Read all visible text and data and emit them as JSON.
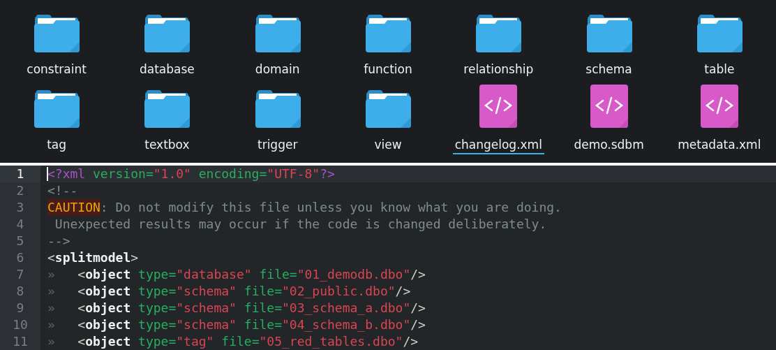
{
  "files": [
    {
      "kind": "folder",
      "name": "constraint",
      "selected": false
    },
    {
      "kind": "folder",
      "name": "database",
      "selected": false
    },
    {
      "kind": "folder",
      "name": "domain",
      "selected": false
    },
    {
      "kind": "folder",
      "name": "function",
      "selected": false
    },
    {
      "kind": "folder",
      "name": "relationship",
      "selected": false
    },
    {
      "kind": "folder",
      "name": "schema",
      "selected": false
    },
    {
      "kind": "folder",
      "name": "table",
      "selected": false
    },
    {
      "kind": "folder",
      "name": "tag",
      "selected": false
    },
    {
      "kind": "folder",
      "name": "textbox",
      "selected": false
    },
    {
      "kind": "folder",
      "name": "trigger",
      "selected": false
    },
    {
      "kind": "folder",
      "name": "view",
      "selected": false
    },
    {
      "kind": "code",
      "name": "changelog.xml",
      "selected": true
    },
    {
      "kind": "code",
      "name": "demo.sdbm",
      "selected": false
    },
    {
      "kind": "code",
      "name": "metadata.xml",
      "selected": false
    }
  ],
  "editor": {
    "lines": [
      {
        "number": "1",
        "current": true,
        "tokens": [
          {
            "kind": "pi",
            "text": "<?xml"
          },
          {
            "kind": "attr",
            "text": " version="
          },
          {
            "kind": "string",
            "text": "\"1.0\""
          },
          {
            "kind": "attr",
            "text": " encoding="
          },
          {
            "kind": "string",
            "text": "\"UTF-8\""
          },
          {
            "kind": "pi",
            "text": "?>"
          }
        ]
      },
      {
        "number": "2",
        "current": false,
        "tokens": [
          {
            "kind": "comment",
            "text": "<!--"
          }
        ]
      },
      {
        "number": "3",
        "current": false,
        "tokens": [
          {
            "kind": "caution",
            "text": "CAUTION"
          },
          {
            "kind": "comment",
            "text": ": Do not modify this file unless you know what you are doing."
          }
        ]
      },
      {
        "number": "4",
        "current": false,
        "tokens": [
          {
            "kind": "comment",
            "text": " Unexpected results may occur if the code is changed deliberately."
          }
        ]
      },
      {
        "number": "5",
        "current": false,
        "tokens": [
          {
            "kind": "comment",
            "text": "-->"
          }
        ]
      },
      {
        "number": "6",
        "current": false,
        "tokens": [
          {
            "kind": "punct",
            "text": "<"
          },
          {
            "kind": "tag",
            "text": "splitmodel"
          },
          {
            "kind": "punct",
            "text": ">"
          }
        ]
      },
      {
        "number": "7",
        "current": false,
        "tokens": [
          {
            "kind": "indent",
            "text": "»"
          },
          {
            "kind": "punct",
            "text": "   <"
          },
          {
            "kind": "tag",
            "text": "object"
          },
          {
            "kind": "attr",
            "text": " type="
          },
          {
            "kind": "string",
            "text": "\"database\""
          },
          {
            "kind": "attr",
            "text": " file="
          },
          {
            "kind": "string",
            "text": "\"01_demodb.dbo\""
          },
          {
            "kind": "punct",
            "text": "/>"
          }
        ]
      },
      {
        "number": "8",
        "current": false,
        "tokens": [
          {
            "kind": "indent",
            "text": "»"
          },
          {
            "kind": "punct",
            "text": "   <"
          },
          {
            "kind": "tag",
            "text": "object"
          },
          {
            "kind": "attr",
            "text": " type="
          },
          {
            "kind": "string",
            "text": "\"schema\""
          },
          {
            "kind": "attr",
            "text": " file="
          },
          {
            "kind": "string",
            "text": "\"02_public.dbo\""
          },
          {
            "kind": "punct",
            "text": "/>"
          }
        ]
      },
      {
        "number": "9",
        "current": false,
        "tokens": [
          {
            "kind": "indent",
            "text": "»"
          },
          {
            "kind": "punct",
            "text": "   <"
          },
          {
            "kind": "tag",
            "text": "object"
          },
          {
            "kind": "attr",
            "text": " type="
          },
          {
            "kind": "string",
            "text": "\"schema\""
          },
          {
            "kind": "attr",
            "text": " file="
          },
          {
            "kind": "string",
            "text": "\"03_schema_a.dbo\""
          },
          {
            "kind": "punct",
            "text": "/>"
          }
        ]
      },
      {
        "number": "10",
        "current": false,
        "tokens": [
          {
            "kind": "indent",
            "text": "»"
          },
          {
            "kind": "punct",
            "text": "   <"
          },
          {
            "kind": "tag",
            "text": "object"
          },
          {
            "kind": "attr",
            "text": " type="
          },
          {
            "kind": "string",
            "text": "\"schema\""
          },
          {
            "kind": "attr",
            "text": " file="
          },
          {
            "kind": "string",
            "text": "\"04_schema_b.dbo\""
          },
          {
            "kind": "punct",
            "text": "/>"
          }
        ]
      },
      {
        "number": "11",
        "current": false,
        "tokens": [
          {
            "kind": "indent",
            "text": "»"
          },
          {
            "kind": "punct",
            "text": "   <"
          },
          {
            "kind": "tag",
            "text": "object"
          },
          {
            "kind": "attr",
            "text": " type="
          },
          {
            "kind": "string",
            "text": "\"tag\""
          },
          {
            "kind": "attr",
            "text": " file="
          },
          {
            "kind": "string",
            "text": "\"05_red_tables.dbo\""
          },
          {
            "kind": "punct",
            "text": "/>"
          }
        ]
      }
    ]
  }
}
